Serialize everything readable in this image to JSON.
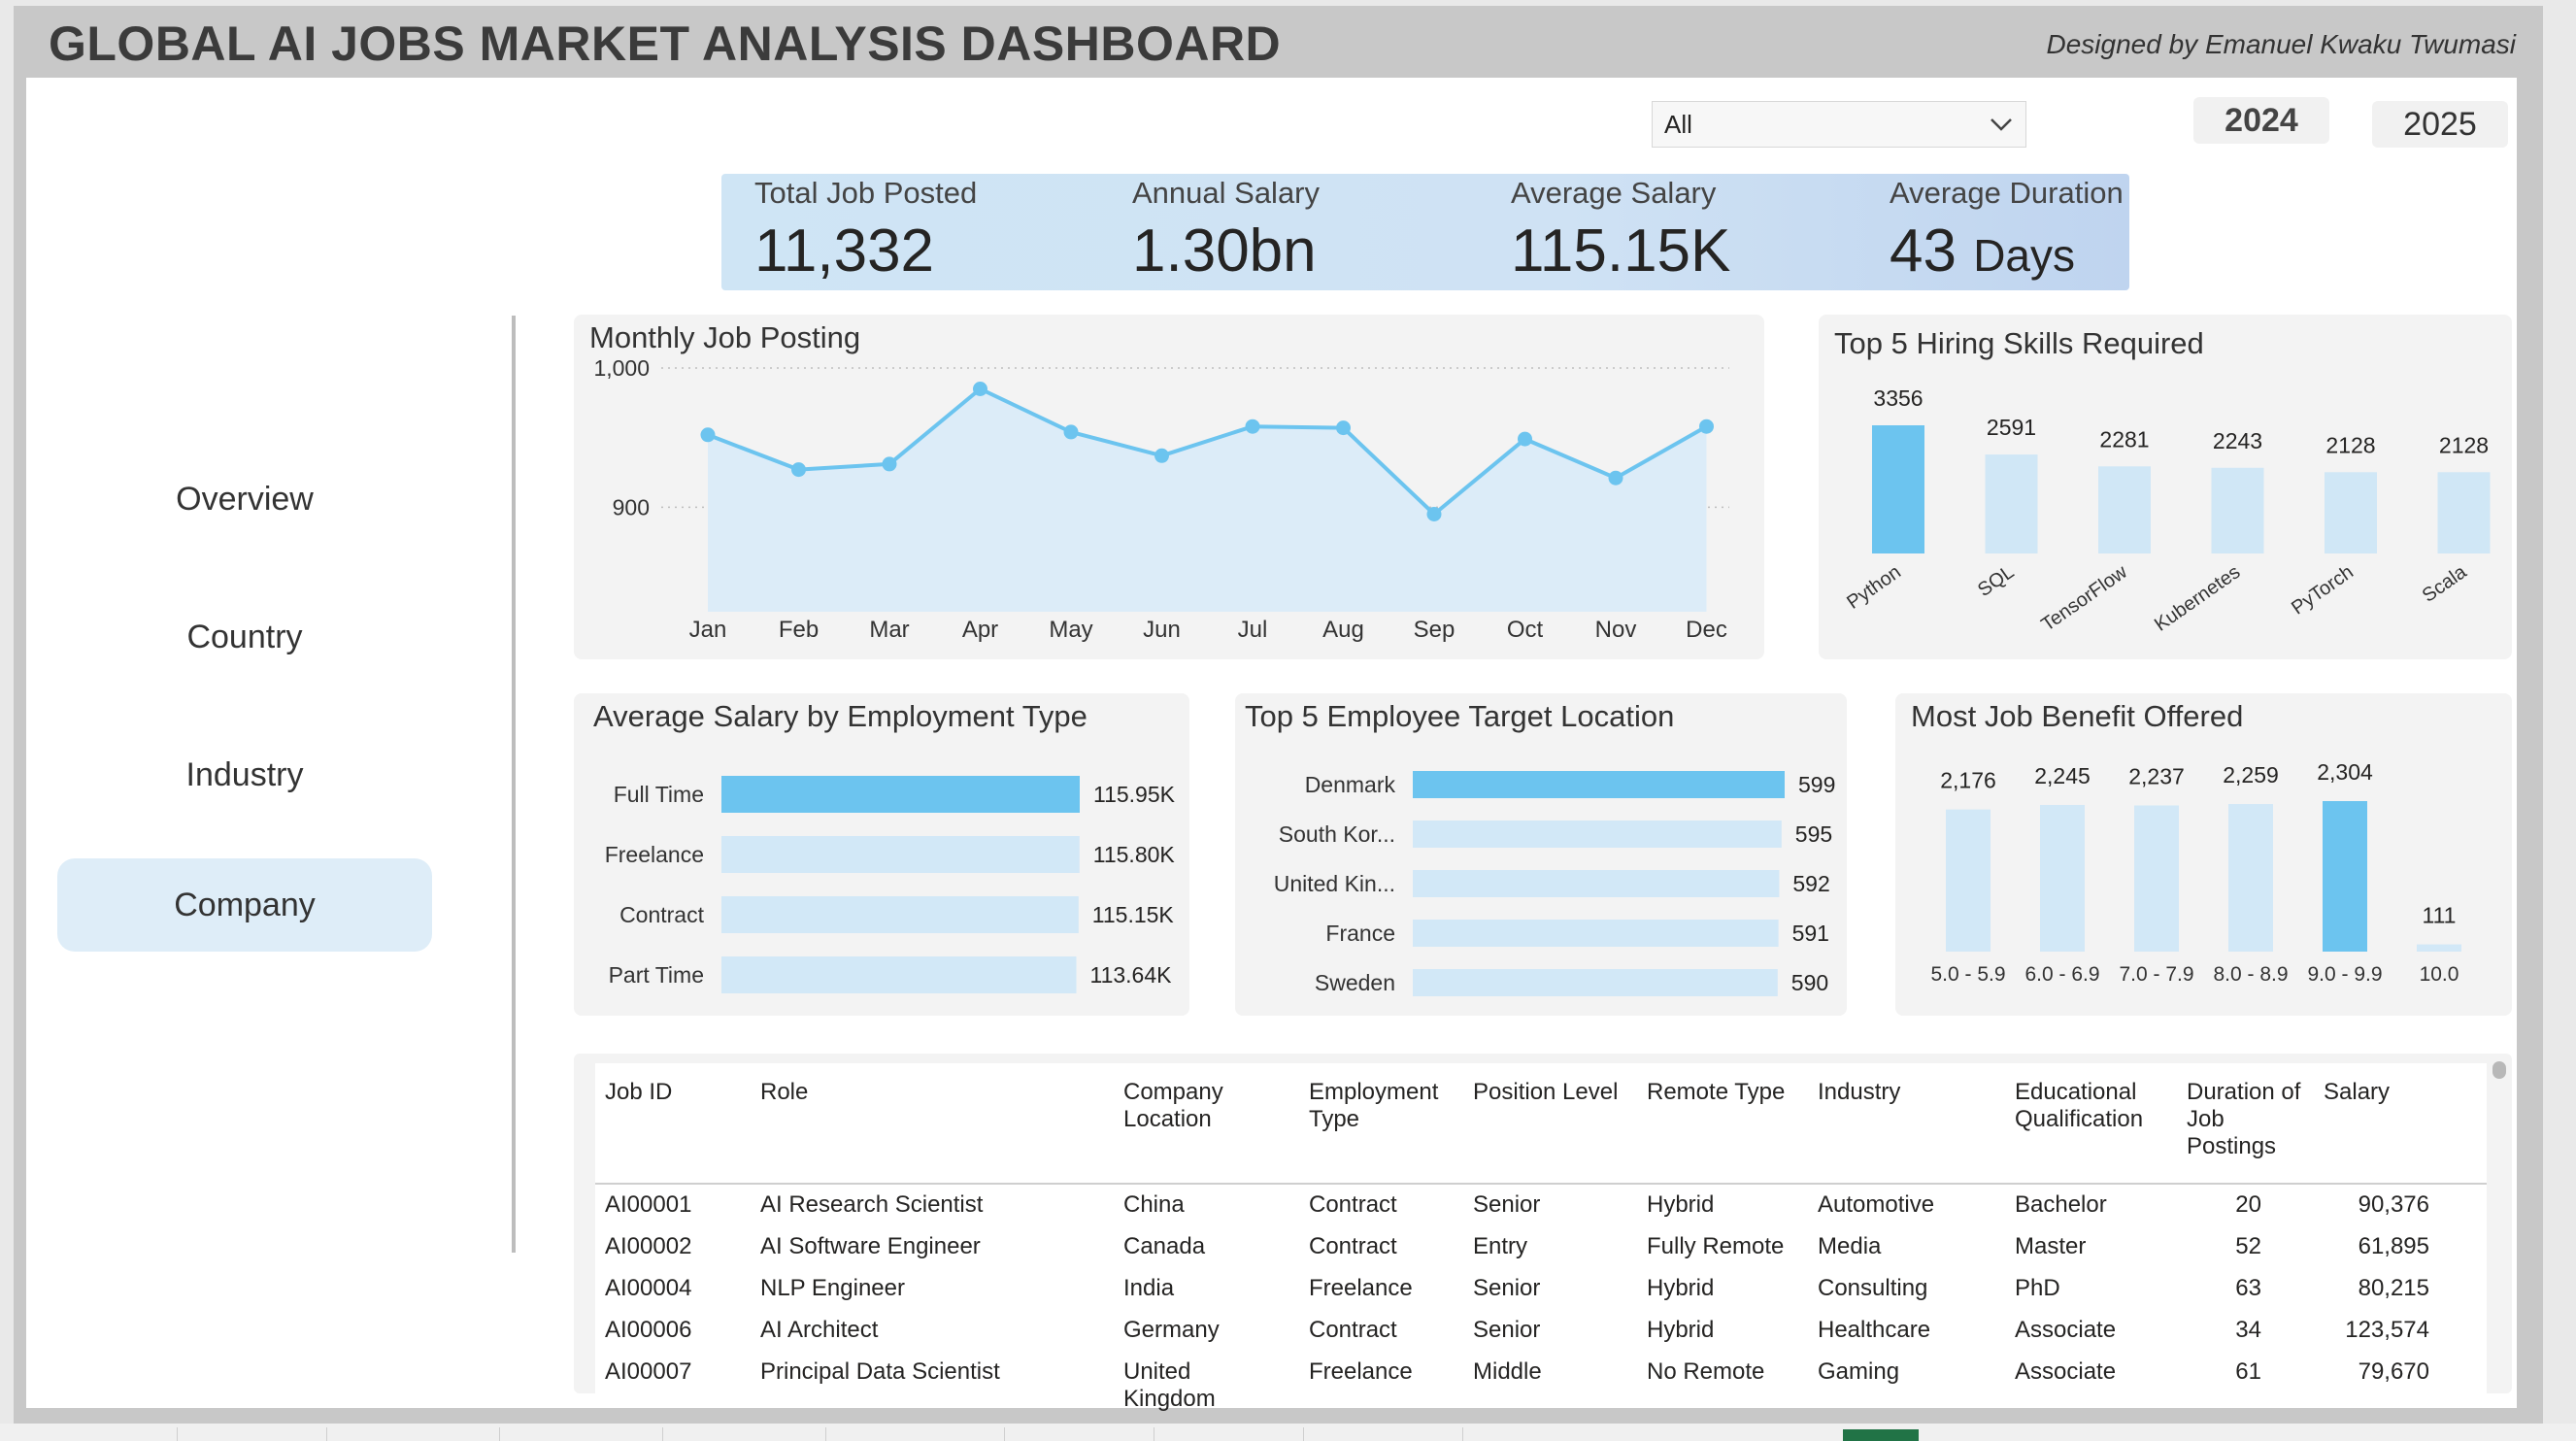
{
  "header": {
    "title": "GLOBAL AI JOBS MARKET ANALYSIS DASHBOARD",
    "credit": "Designed by Emanuel Kwaku Twumasi"
  },
  "nav": {
    "items": [
      {
        "label": "Overview"
      },
      {
        "label": "Country"
      },
      {
        "label": "Industry"
      },
      {
        "label": "Company",
        "active": true
      }
    ]
  },
  "filters": {
    "dropdown_value": "All",
    "years": [
      "2024",
      "2025"
    ],
    "selected_year": "2024"
  },
  "kpis": [
    {
      "label": "Total Job Posted",
      "value": "11,332",
      "unit": ""
    },
    {
      "label": "Annual Salary",
      "value": "1.30bn",
      "unit": ""
    },
    {
      "label": "Average Salary",
      "value": "115.15K",
      "unit": ""
    },
    {
      "label": "Average Duration",
      "value": "43",
      "unit": "Days"
    }
  ],
  "panels": {
    "monthly": "Monthly Job Posting",
    "skills": "Top 5 Hiring Skills Required",
    "salary_type": "Average Salary by Employment Type",
    "location": "Top 5 Employee Target Location",
    "benefit": "Most Job Benefit Offered"
  },
  "chart_data": [
    {
      "type": "area",
      "title": "Monthly Job Posting",
      "categories": [
        "Jan",
        "Feb",
        "Mar",
        "Apr",
        "May",
        "Jun",
        "Jul",
        "Aug",
        "Sep",
        "Oct",
        "Nov",
        "Dec"
      ],
      "values": [
        952,
        927,
        931,
        985,
        954,
        937,
        958,
        957,
        895,
        949,
        921,
        958
      ],
      "yticks": [
        "1,000",
        "900"
      ],
      "ylim": [
        850,
        1000
      ],
      "grid": true,
      "color": "#6cc4ef"
    },
    {
      "type": "bar",
      "title": "Top 5 Hiring Skills Required",
      "categories": [
        "Python",
        "SQL",
        "TensorFlow",
        "Kubernetes",
        "PyTorch",
        "Scala"
      ],
      "values": [
        3356,
        2591,
        2281,
        2243,
        2128,
        2128
      ],
      "labels": [
        "3356",
        "2591",
        "2281",
        "2243",
        "2128",
        "2128"
      ],
      "highlight_color": "#6cc4ef",
      "color": "#d0e7f6"
    },
    {
      "type": "bar",
      "orientation": "horizontal",
      "title": "Average Salary by Employment Type",
      "categories": [
        "Full Time",
        "Freelance",
        "Contract",
        "Part Time"
      ],
      "values": [
        115950,
        115800,
        115150,
        113640
      ],
      "labels": [
        "115.95K",
        "115.80K",
        "115.15K",
        "113.64K"
      ]
    },
    {
      "type": "bar",
      "orientation": "horizontal",
      "title": "Top 5 Employee Target Location",
      "categories": [
        "Denmark",
        "South Kor...",
        "United Kin...",
        "France",
        "Sweden"
      ],
      "values": [
        599,
        595,
        592,
        591,
        590
      ],
      "labels": [
        "599",
        "595",
        "592",
        "591",
        "590"
      ]
    },
    {
      "type": "bar",
      "title": "Most Job Benefit Offered",
      "categories": [
        "5.0 - 5.9",
        "6.0 - 6.9",
        "7.0 - 7.9",
        "8.0 - 8.9",
        "9.0 - 9.9",
        "10.0"
      ],
      "values": [
        2176,
        2245,
        2237,
        2259,
        2304,
        111
      ],
      "labels": [
        "2,176",
        "2,245",
        "2,237",
        "2,259",
        "2,304",
        "111"
      ]
    }
  ],
  "table": {
    "headers": [
      "Job ID",
      "Role",
      "Company Location",
      "Employment Type",
      "Position Level",
      "Remote Type",
      "Industry",
      "Educational Qualification",
      "Duration of Job Postings",
      "Salary"
    ],
    "rows": [
      [
        "AI00001",
        "AI Research Scientist",
        "China",
        "Contract",
        "Senior",
        "Hybrid",
        "Automotive",
        "Bachelor",
        "20",
        "90,376"
      ],
      [
        "AI00002",
        "AI Software Engineer",
        "Canada",
        "Contract",
        "Entry",
        "Fully Remote",
        "Media",
        "Master",
        "52",
        "61,895"
      ],
      [
        "AI00004",
        "NLP Engineer",
        "India",
        "Freelance",
        "Senior",
        "Hybrid",
        "Consulting",
        "PhD",
        "63",
        "80,215"
      ],
      [
        "AI00006",
        "AI Architect",
        "Germany",
        "Contract",
        "Senior",
        "Hybrid",
        "Healthcare",
        "Associate",
        "34",
        "123,574"
      ],
      [
        "AI00007",
        "Principal Data Scientist",
        "United Kingdom",
        "Freelance",
        "Middle",
        "No Remote",
        "Gaming",
        "Associate",
        "61",
        "79,670"
      ]
    ]
  }
}
